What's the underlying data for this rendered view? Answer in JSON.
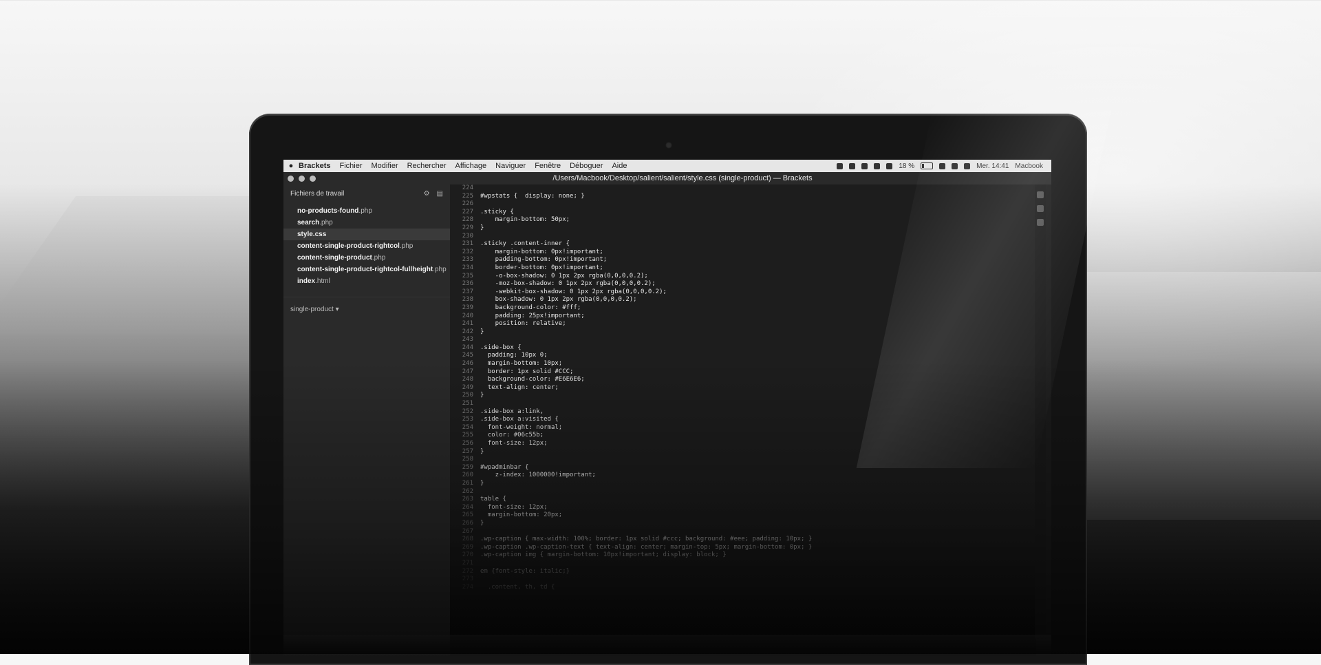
{
  "menubar": {
    "items": [
      "Brackets",
      "Fichier",
      "Modifier",
      "Rechercher",
      "Affichage",
      "Naviguer",
      "Fenêtre",
      "Déboguer",
      "Aide"
    ],
    "battery": "18 %",
    "clock": "Mer. 14:41",
    "user": "Macbook"
  },
  "window": {
    "title": "/Users/Macbook/Desktop/salient/salient/style.css (single-product) — Brackets"
  },
  "sidebar": {
    "header": "Fichiers de travail",
    "files": [
      {
        "name": "no-products-found",
        "ext": ".php"
      },
      {
        "name": "search",
        "ext": ".php"
      },
      {
        "name": "style.css",
        "ext": ""
      },
      {
        "name": "content-single-product-rightcol",
        "ext": ".php"
      },
      {
        "name": "content-single-product",
        "ext": ".php"
      },
      {
        "name": "content-single-product-rightcol-fullheight",
        "ext": ".php"
      },
      {
        "name": "index",
        "ext": ".html"
      }
    ],
    "project": "single-product ▾"
  },
  "code": [
    {
      "n": "224",
      "t": ""
    },
    {
      "n": "225",
      "t": "#wpstats {  display: none; }"
    },
    {
      "n": "226",
      "t": ""
    },
    {
      "n": "227",
      "t": ".sticky {"
    },
    {
      "n": "228",
      "t": "    margin-bottom: 50px;"
    },
    {
      "n": "229",
      "t": "}"
    },
    {
      "n": "230",
      "t": ""
    },
    {
      "n": "231",
      "t": ".sticky .content-inner {"
    },
    {
      "n": "232",
      "t": "    margin-bottom: 0px!important;"
    },
    {
      "n": "233",
      "t": "    padding-bottom: 0px!important;"
    },
    {
      "n": "234",
      "t": "    border-bottom: 0px!important;"
    },
    {
      "n": "235",
      "t": "    -o-box-shadow: 0 1px 2px rgba(0,0,0,0.2);"
    },
    {
      "n": "236",
      "t": "    -moz-box-shadow: 0 1px 2px rgba(0,0,0,0.2);"
    },
    {
      "n": "237",
      "t": "    -webkit-box-shadow: 0 1px 2px rgba(0,0,0,0.2);"
    },
    {
      "n": "238",
      "t": "    box-shadow: 0 1px 2px rgba(0,0,0,0.2);"
    },
    {
      "n": "239",
      "t": "    background-color: #fff;"
    },
    {
      "n": "240",
      "t": "    padding: 25px!important;"
    },
    {
      "n": "241",
      "t": "    position: relative;"
    },
    {
      "n": "242",
      "t": "}"
    },
    {
      "n": "243",
      "t": ""
    },
    {
      "n": "244",
      "t": ".side-box {"
    },
    {
      "n": "245",
      "t": "  padding: 10px 0;"
    },
    {
      "n": "246",
      "t": "  margin-bottom: 10px;"
    },
    {
      "n": "247",
      "t": "  border: 1px solid #CCC;"
    },
    {
      "n": "248",
      "t": "  background-color: #E6E6E6;"
    },
    {
      "n": "249",
      "t": "  text-align: center;"
    },
    {
      "n": "250",
      "t": "}"
    },
    {
      "n": "251",
      "t": ""
    },
    {
      "n": "252",
      "t": ".side-box a:link,"
    },
    {
      "n": "253",
      "t": ".side-box a:visited {"
    },
    {
      "n": "254",
      "t": "  font-weight: normal;"
    },
    {
      "n": "255",
      "t": "  color: #06c55b;"
    },
    {
      "n": "256",
      "t": "  font-size: 12px;"
    },
    {
      "n": "257",
      "t": "}"
    },
    {
      "n": "258",
      "t": ""
    },
    {
      "n": "259",
      "t": "#wpadminbar {"
    },
    {
      "n": "260",
      "t": "    z-index: 1000000!important;"
    },
    {
      "n": "261",
      "t": "}"
    },
    {
      "n": "262",
      "t": ""
    },
    {
      "n": "263",
      "t": "table {"
    },
    {
      "n": "264",
      "t": "  font-size: 12px;"
    },
    {
      "n": "265",
      "t": "  margin-bottom: 20px;"
    },
    {
      "n": "266",
      "t": "}"
    },
    {
      "n": "267",
      "t": ""
    },
    {
      "n": "268",
      "t": ".wp-caption { max-width: 100%; border: 1px solid #ccc; background: #eee; padding: 10px; }"
    },
    {
      "n": "269",
      "t": ".wp-caption .wp-caption-text { text-align: center; margin-top: 5px; margin-bottom: 0px; }"
    },
    {
      "n": "270",
      "t": ".wp-caption img { margin-bottom: 10px!important; display: block; }"
    },
    {
      "n": "271",
      "t": ""
    },
    {
      "n": "272",
      "t": "em {font-style: italic;}"
    },
    {
      "n": "273",
      "t": ""
    },
    {
      "n": "274",
      "t": "  .content, th, td {"
    }
  ]
}
